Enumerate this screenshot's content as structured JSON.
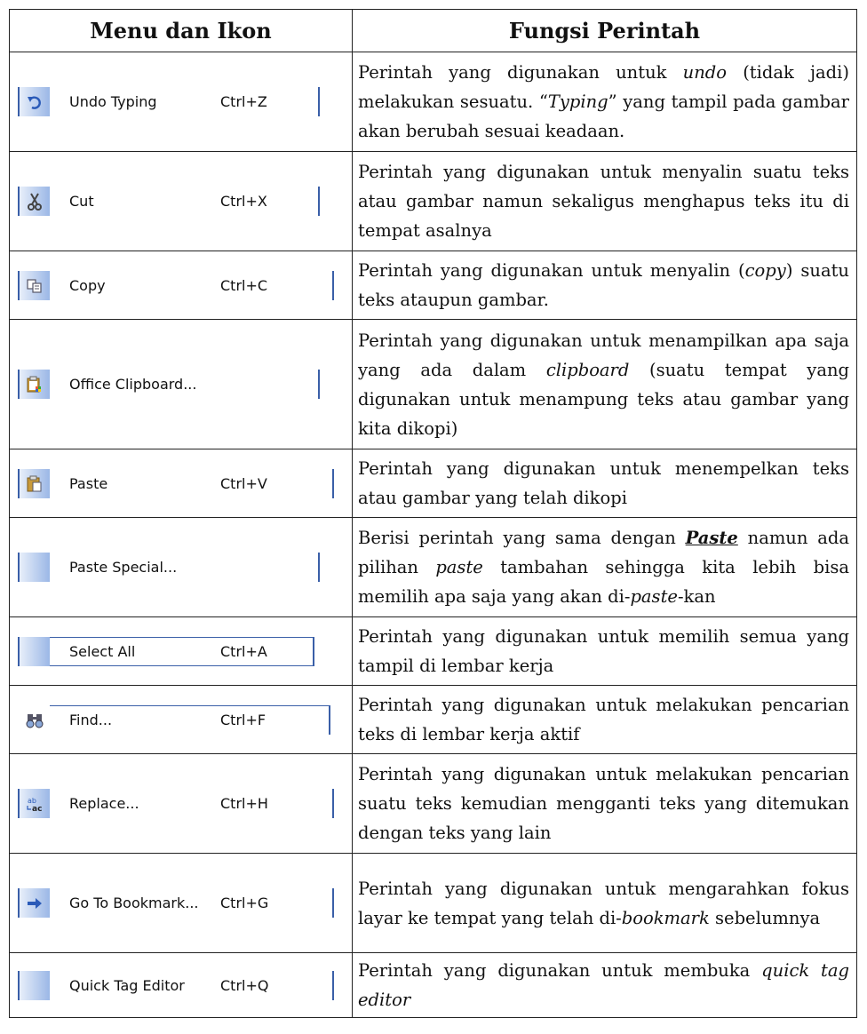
{
  "header": {
    "col1": "Menu dan Ikon",
    "col2": "Fungsi Perintah"
  },
  "rows": [
    {
      "menu": {
        "label": "Undo Typing",
        "shortcut": "Ctrl+Z",
        "icon": "undo-icon"
      },
      "desc": {
        "a": "Perintah yang digunakan untuk ",
        "b": "undo",
        "c": " (tidak jadi) melakukan sesuatu. “",
        "d": "Typing",
        "e": "” yang tampil pada gambar akan berubah sesuai keadaan."
      }
    },
    {
      "menu": {
        "label": "Cut",
        "shortcut": "Ctrl+X",
        "icon": "scissors-icon"
      },
      "desc": {
        "a": "Perintah yang digunakan untuk menyalin suatu teks atau gambar namun sekaligus menghapus teks itu di tempat asalnya"
      }
    },
    {
      "menu": {
        "label": "Copy",
        "shortcut": "Ctrl+C",
        "icon": "copy-icon"
      },
      "desc": {
        "a": "Perintah yang digunakan untuk menyalin (",
        "b": "copy",
        "c": ") suatu teks ataupun gambar."
      }
    },
    {
      "menu": {
        "label": "Office Clipboard...",
        "shortcut": "",
        "icon": "clipboard-icon"
      },
      "desc": {
        "a": "Perintah yang digunakan untuk menampilkan apa saja yang ada dalam ",
        "b": "clipboard",
        "c": " (suatu tempat yang digunakan untuk menampung teks atau gambar yang kita dikopi)"
      }
    },
    {
      "menu": {
        "label": "Paste",
        "shortcut": "Ctrl+V",
        "icon": "paste-icon"
      },
      "desc": {
        "a": "Perintah yang digunakan untuk menempelkan teks atau gambar yang telah dikopi"
      }
    },
    {
      "menu": {
        "label": "Paste Special...",
        "shortcut": "",
        "icon": ""
      },
      "desc": {
        "a": "Berisi perintah yang sama dengan ",
        "b": "Paste",
        "c": " namun ada pilihan ",
        "d": "paste",
        "e": " tambahan sehingga kita lebih bisa memilih apa saja yang akan di-",
        "f": "paste",
        "g": "-kan"
      }
    },
    {
      "menu": {
        "label": "Select All",
        "shortcut": "Ctrl+A",
        "icon": ""
      },
      "desc": {
        "a": "Perintah yang digunakan untuk memilih semua yang tampil di lembar kerja"
      }
    },
    {
      "menu": {
        "label": "Find...",
        "shortcut": "Ctrl+F",
        "icon": "binoculars-icon"
      },
      "desc": {
        "a": "Perintah yang digunakan untuk melakukan pencarian teks di lembar kerja aktif"
      }
    },
    {
      "menu": {
        "label": "Replace...",
        "shortcut": "Ctrl+H",
        "icon": "replace-icon"
      },
      "desc": {
        "a": "Perintah yang digunakan untuk melakukan pencarian suatu teks kemudian mengganti teks yang ditemukan dengan teks yang lain"
      }
    },
    {
      "menu": {
        "label": "Go To Bookmark...",
        "shortcut": "Ctrl+G",
        "icon": "arrow-right-icon"
      },
      "desc": {
        "a": "Perintah yang digunakan untuk mengarahkan fokus layar ke tempat yang telah di-",
        "b": "bookmark",
        "c": " sebelumnya"
      }
    },
    {
      "menu": {
        "label": "Quick Tag Editor",
        "shortcut": "Ctrl+Q",
        "icon": ""
      },
      "desc": {
        "a": "Perintah yang digunakan untuk membuka ",
        "b": "quick tag editor"
      }
    }
  ]
}
